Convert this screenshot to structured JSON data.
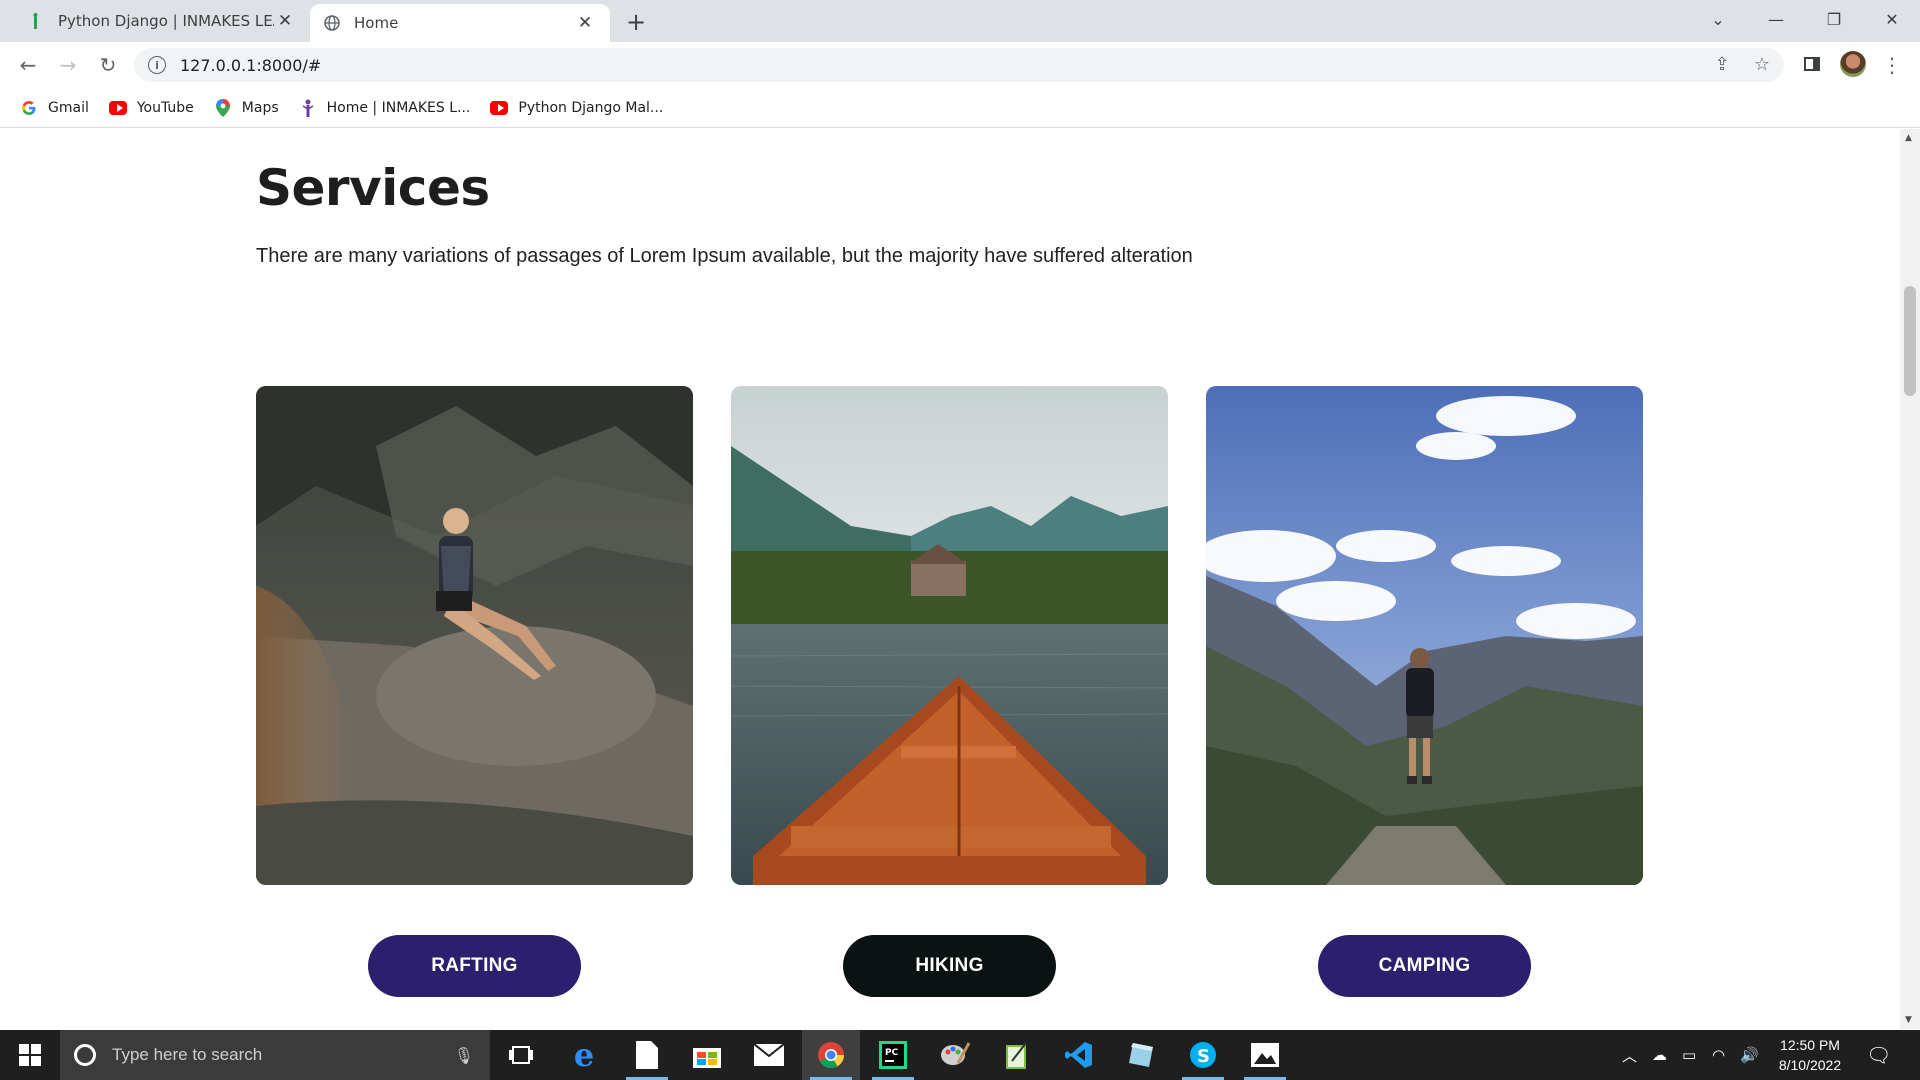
{
  "browser": {
    "tabs": [
      {
        "title": "Python Django | INMAKES LEARN",
        "active": false
      },
      {
        "title": "Home",
        "active": true
      }
    ],
    "url": "127.0.0.1:8000/#",
    "bookmarks": [
      {
        "label": "Gmail",
        "icon": "google-icon"
      },
      {
        "label": "YouTube",
        "icon": "youtube-icon"
      },
      {
        "label": "Maps",
        "icon": "maps-icon"
      },
      {
        "label": "Home | INMAKES L...",
        "icon": "inmakes-icon"
      },
      {
        "label": "Python Django Mal...",
        "icon": "youtube-icon"
      }
    ]
  },
  "page": {
    "title": "Services",
    "subtitle": "There are many variations of passages of Lorem Ipsum available, but the majority have suffered alteration",
    "services": [
      {
        "label": "RAFTING",
        "image": "man-sitting-on-rock",
        "button_color": "#2b1f6e"
      },
      {
        "label": "HIKING",
        "image": "boat-on-mountain-lake",
        "button_color": "#0b1212"
      },
      {
        "label": "CAMPING",
        "image": "hiker-on-mountain-peak",
        "button_color": "#2b1f6e"
      }
    ]
  },
  "taskbar": {
    "search_placeholder": "Type here to search",
    "time": "12:50 PM",
    "date": "8/10/2022"
  },
  "colors": {
    "accent_purple": "#2b1f6e",
    "dark_button": "#0b1212",
    "taskbar": "#1f1f1f"
  }
}
